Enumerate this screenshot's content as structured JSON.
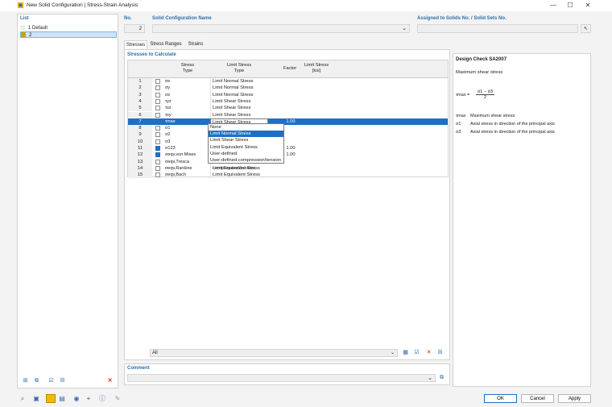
{
  "window": {
    "title": "New Solid Configuration | Stress-Strain Analysis"
  },
  "list": {
    "header": "List",
    "items": [
      {
        "label": "1  Default",
        "color": "#e6f2d9"
      },
      {
        "label": "2",
        "color": "#c9a400"
      }
    ]
  },
  "no": {
    "label": "No.",
    "value": "2"
  },
  "config_name": {
    "label": "Solid Configuration Name",
    "value": ""
  },
  "assigned": {
    "label": "Assigned to Solids No. / Solid Sets No.",
    "value": ""
  },
  "tabs": [
    "Stresses",
    "Stress Ranges",
    "Strains"
  ],
  "stresses": {
    "section_title": "Stresses to Calculate",
    "headers": {
      "stress_type": [
        "Stress",
        "Type"
      ],
      "limit_type": [
        "Limit Stress",
        "Type"
      ],
      "factor": "Factor",
      "limit_stress": [
        "Limit Stress",
        "[ksi]"
      ]
    },
    "rows": [
      {
        "n": "1",
        "sym": "σx",
        "limit": "Limit Normal Stress",
        "factor": "",
        "checked": false
      },
      {
        "n": "2",
        "sym": "σy",
        "limit": "Limit Normal Stress",
        "factor": "",
        "checked": false
      },
      {
        "n": "3",
        "sym": "σz",
        "limit": "Limit Normal Stress",
        "factor": "",
        "checked": false
      },
      {
        "n": "4",
        "sym": "τyz",
        "limit": "Limit Shear Stress",
        "factor": "",
        "checked": false
      },
      {
        "n": "5",
        "sym": "τxz",
        "limit": "Limit Shear Stress",
        "factor": "",
        "checked": false
      },
      {
        "n": "6",
        "sym": "τxy",
        "limit": "Limit Shear Stress",
        "factor": "",
        "checked": false
      },
      {
        "n": "7",
        "sym": "τmax",
        "limit": "Limit Shear Stress",
        "factor": "1.00",
        "checked": true
      },
      {
        "n": "8",
        "sym": "σ1",
        "limit": "None",
        "factor": "",
        "checked": false
      },
      {
        "n": "9",
        "sym": "σ2",
        "limit": "Limit Normal Stress",
        "factor": "",
        "checked": false
      },
      {
        "n": "10",
        "sym": "σ3",
        "limit": "Limit Shear Stress",
        "factor": "",
        "checked": false
      },
      {
        "n": "11",
        "sym": "σ123",
        "limit": "Limit Equivalent Stress",
        "factor": "1.00",
        "checked": true
      },
      {
        "n": "12",
        "sym": "σeqv,von Mises",
        "limit": "User-defined",
        "factor": "1.00",
        "checked": true
      },
      {
        "n": "13",
        "sym": "σeqv,Tresca",
        "limit": "User-defined compression/tension",
        "factor": "",
        "checked": false
      },
      {
        "n": "14",
        "sym": "σeqv,Rankine",
        "limit": "Limit Equivalent Stress",
        "factor": "",
        "checked": false
      },
      {
        "n": "15",
        "sym": "σeqv,Bach",
        "limit": "Limit Equivalent Stress",
        "factor": "",
        "checked": false
      }
    ],
    "dropdown_options": [
      "None",
      "Limit Normal Stress",
      "Limit Shear Stress",
      "Limit Equivalent Stress",
      "User-defined",
      "User-defined compression/tension"
    ],
    "dropdown_highlight": "Limit Normal Stress",
    "filter_value": "All"
  },
  "design_check": {
    "title": "Design Check SA2007",
    "subtitle": "Maximum shear stress",
    "formula_lhs": "τmax =",
    "formula_num": "σ1 − σ3",
    "formula_den": "2",
    "legend": [
      {
        "sym": "τmax",
        "desc": "Maximum shear stress"
      },
      {
        "sym": "σ1",
        "desc": "Axial stress in direction of the principal axis"
      },
      {
        "sym": "σ3",
        "desc": "Axial stress in direction of the principal axis"
      }
    ]
  },
  "comment": {
    "label": "Comment",
    "value": ""
  },
  "buttons": {
    "ok": "OK",
    "cancel": "Cancel",
    "apply": "Apply"
  }
}
